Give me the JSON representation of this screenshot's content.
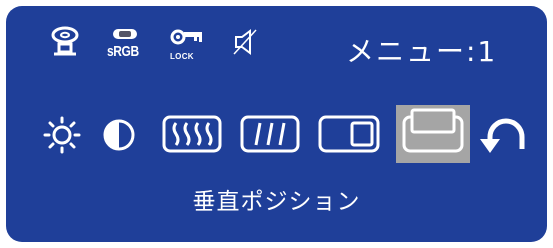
{
  "osd": {
    "menu_title": "メニュー:1",
    "selected_item_label": "垂直ポジション",
    "background_color": "#1f3f99",
    "highlight_color": "#a5a5a5",
    "text_color": "#ffffff"
  },
  "status_icons": {
    "input_icon": "input-signal-icon",
    "srgb_label": "sRGB",
    "lock_label": "LOCK",
    "mute_icon": "speaker-muted-icon"
  },
  "menu_items": [
    {
      "icon": "brightness-sun-icon",
      "selected": false
    },
    {
      "icon": "contrast-circle-icon",
      "selected": false
    },
    {
      "icon": "clock-wave-icon",
      "selected": false
    },
    {
      "icon": "phase-lines-icon",
      "selected": false
    },
    {
      "icon": "horizontal-position-icon",
      "selected": false
    },
    {
      "icon": "vertical-position-icon",
      "selected": true
    },
    {
      "icon": "return-arrow-icon",
      "selected": false
    }
  ]
}
